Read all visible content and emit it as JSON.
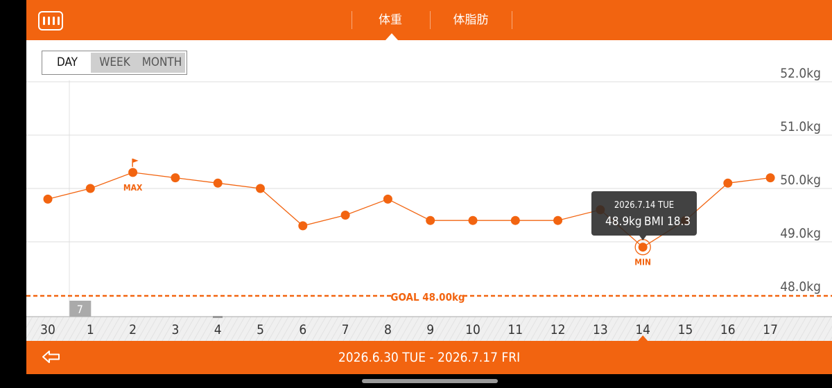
{
  "header": {
    "tabs": [
      {
        "label": "体重",
        "selected": true
      },
      {
        "label": "体脂肪",
        "selected": false
      }
    ],
    "menu_icon": "scale-ruler-icon"
  },
  "range_toggle": {
    "options": [
      "DAY",
      "WEEK",
      "MONTH"
    ],
    "selected": "DAY"
  },
  "chart_data": {
    "type": "line",
    "y_unit": "kg",
    "ylim": [
      47.5,
      52.5
    ],
    "y_ticks": [
      "52.0kg",
      "51.0kg",
      "50.0kg",
      "49.0kg",
      "48.0kg"
    ],
    "y_tick_values": [
      52,
      51,
      50,
      49,
      48
    ],
    "x": [
      "30",
      "1",
      "2",
      "3",
      "4",
      "5",
      "6",
      "7",
      "8",
      "9",
      "10",
      "11",
      "12",
      "13",
      "14",
      "15",
      "16",
      "17"
    ],
    "values": [
      49.8,
      50.0,
      50.3,
      50.2,
      50.1,
      50.0,
      49.3,
      49.5,
      49.8,
      49.4,
      49.4,
      49.4,
      49.4,
      49.6,
      48.9,
      49.4,
      50.1,
      50.2
    ],
    "max_label": "MAX",
    "max_index": 2,
    "min_label": "MIN",
    "min_index": 14,
    "goal": {
      "label": "GOAL 48.00kg",
      "value": 48.0
    },
    "month_marker": "7",
    "month_marker_index": 1,
    "selected_index": 14,
    "tooltip": {
      "date": "2026.7.14 TUE",
      "weight": "48.9kg",
      "bmi": "BMI 18.3"
    },
    "colors": {
      "line": "#f26410",
      "goal": "#f26410",
      "grid": "#dcdcdc"
    },
    "grid": true
  },
  "footer": {
    "back_icon": "back-arrow-icon",
    "range_title": "2026.6.30 TUE - 2026.7.17 FRI"
  },
  "colors": {
    "accent": "#f26410",
    "tooltip_bg": "#3a3a3a"
  }
}
